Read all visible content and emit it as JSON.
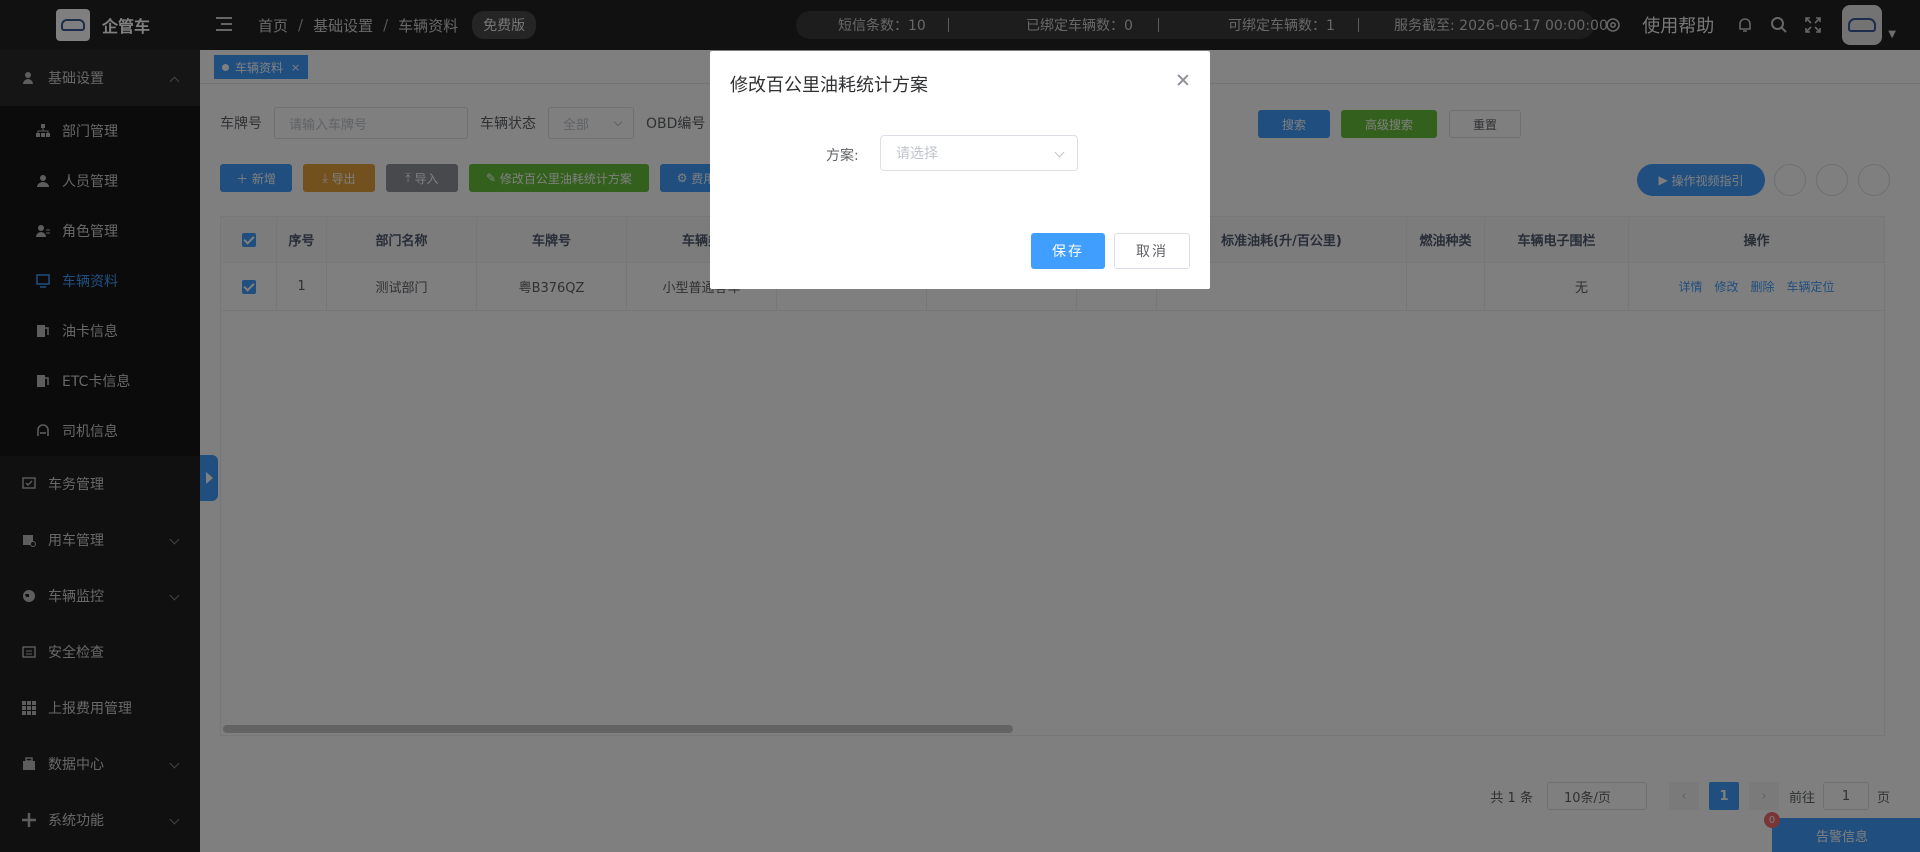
{
  "app": {
    "title": "企管车"
  },
  "breadcrumb": [
    "首页",
    "基础设置",
    "车辆资料"
  ],
  "edition_badge": "免费版",
  "stats": {
    "sms": "短信条数：10",
    "bound": "已绑定车辆数：0",
    "bindable": "可绑定车辆数：1",
    "expiry": "服务截至: 2026-06-17 00:00:00"
  },
  "help": "使用帮助",
  "sidebar": {
    "groups": [
      {
        "label": "基础设置",
        "open": true,
        "items": [
          {
            "label": "部门管理"
          },
          {
            "label": "人员管理"
          },
          {
            "label": "角色管理"
          },
          {
            "label": "车辆资料",
            "active": true
          },
          {
            "label": "油卡信息"
          },
          {
            "label": "ETC卡信息"
          },
          {
            "label": "司机信息"
          }
        ]
      },
      {
        "label": "车务管理"
      },
      {
        "label": "用车管理"
      },
      {
        "label": "车辆监控"
      },
      {
        "label": "安全检查"
      },
      {
        "label": "上报费用管理"
      },
      {
        "label": "数据中心"
      },
      {
        "label": "系统功能"
      }
    ]
  },
  "tabs": {
    "active": "车辆资料"
  },
  "filters": {
    "plate_label": "车牌号",
    "plate_placeholder": "请输入车牌号",
    "status_label": "车辆状态",
    "status_value": "全部",
    "obd_label": "OBD编号",
    "search": "搜索",
    "advanced": "高级搜索",
    "reset": "重置"
  },
  "toolbar": {
    "add": "新增",
    "export": "导出",
    "import": "导入",
    "fuel_plan": "修改百公里油耗统计方案",
    "fee": "费用",
    "video": "操作视频指引"
  },
  "table": {
    "headers": [
      "序号",
      "部门名称",
      "车牌号",
      "车辆类",
      "标准油耗(升/百公里)",
      "燃油种类",
      "车辆电子围栏",
      "操作"
    ],
    "rows": [
      {
        "index": "1",
        "dept": "测试部门",
        "plate": "粤B376QZ",
        "type": "小型普通客车",
        "fence": "无"
      }
    ],
    "ops": [
      "详情",
      "修改",
      "删除",
      "车辆定位"
    ]
  },
  "pagination": {
    "total": "共 1 条",
    "size": "10条/页",
    "current": "1",
    "goto": "前往",
    "goto_value": "1",
    "page_unit": "页"
  },
  "alert": {
    "label": "告警信息",
    "count": "0"
  },
  "dialog": {
    "title": "修改百公里油耗统计方案",
    "field_label": "方案:",
    "field_placeholder": "请选择",
    "save": "保存",
    "cancel": "取消"
  },
  "colors": {
    "primary": "#409eff",
    "sidebar": "#212121",
    "topbar": "#222222"
  }
}
